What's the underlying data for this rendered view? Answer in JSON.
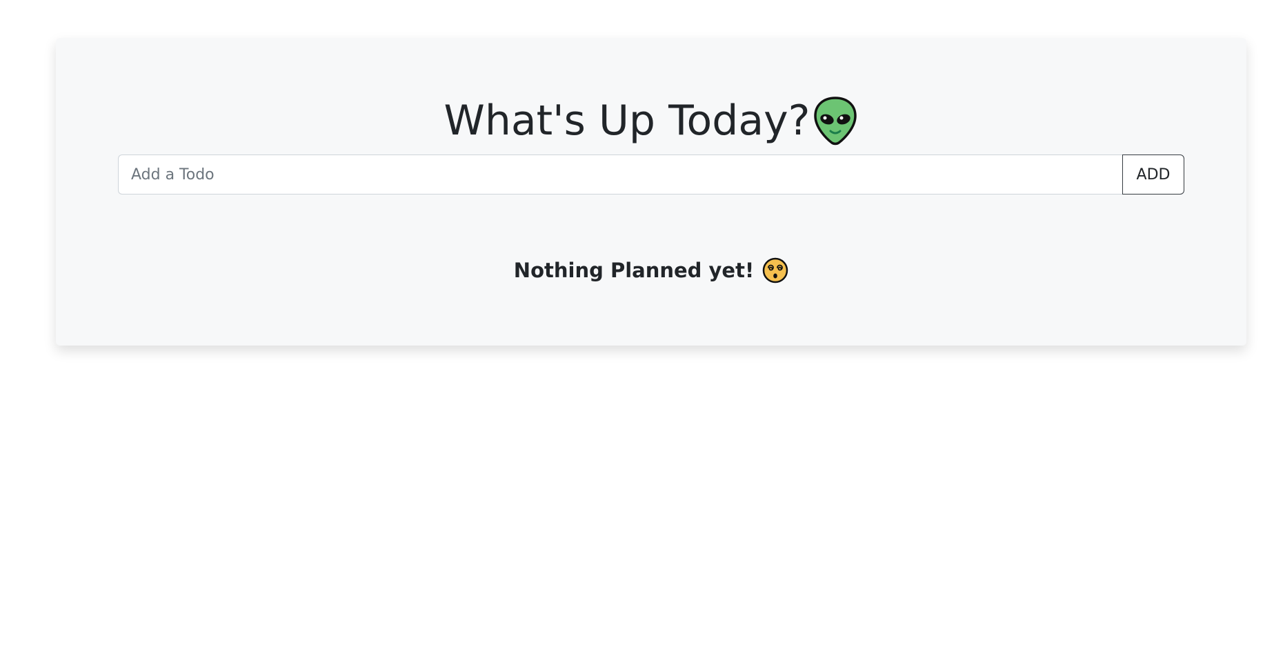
{
  "header": {
    "title": "What's Up Today?",
    "title_icon": "alien-icon"
  },
  "form": {
    "input_placeholder": "Add a Todo",
    "input_value": "",
    "add_label": "ADD"
  },
  "empty_state": {
    "message": "Nothing Planned yet!",
    "icon": "dizzy-face-icon"
  },
  "colors": {
    "card_background": "#f7f8f9",
    "text": "#212529",
    "placeholder": "#6c757d",
    "alien_green": "#6cc473",
    "emoji_yellow": "#f5c04f"
  }
}
